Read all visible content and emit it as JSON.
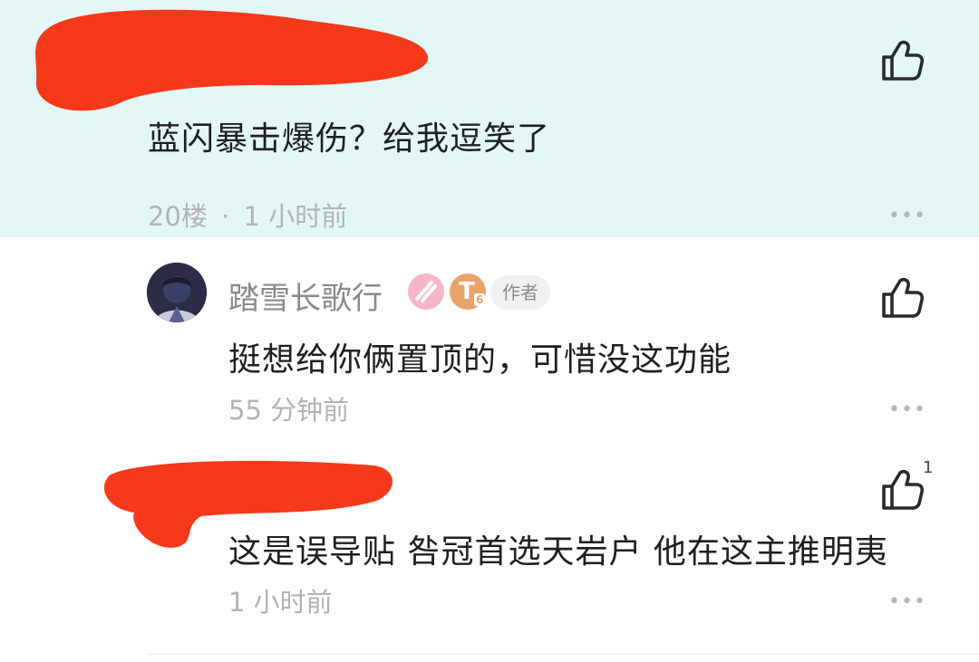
{
  "comments": [
    {
      "text": "蓝闪暴击爆伤？给我逗笑了",
      "floor": "20楼",
      "time": "1 小时前",
      "like_icon": "thumbs-up-icon",
      "more_icon": "more-dots-icon"
    },
    {
      "username": "踏雪长歌行",
      "author_tag": "作者",
      "badge_1_icon": "pink-badge-icon",
      "badge_2_letter": "T",
      "badge_2_sub": "6",
      "text": "挺想给你俩置顶的，可惜没这功能",
      "time": "55 分钟前",
      "like_icon": "thumbs-up-icon",
      "more_icon": "more-dots-icon"
    },
    {
      "text": "这是误导贴 咎冠首选天岩户 他在这主推明夷",
      "time": "1 小时前",
      "like_count": "1",
      "like_icon": "thumbs-up-icon",
      "more_icon": "more-dots-icon"
    }
  ],
  "meta_separator": "·",
  "more_glyph": "•••",
  "colors": {
    "highlight_bg": "#e3f7f7",
    "redaction": "#f5391a",
    "meta_text": "#b3b3b3"
  }
}
